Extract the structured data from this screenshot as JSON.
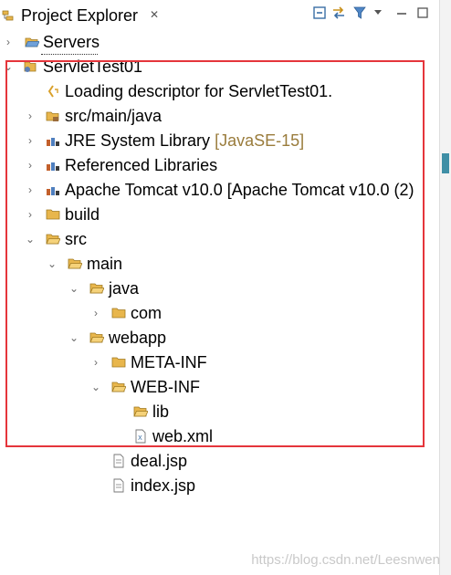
{
  "tab": {
    "title": "Project Explorer",
    "close": "✕"
  },
  "toolbar": [
    "collapse-all-icon",
    "link-with-editor-icon",
    "filter-icon",
    "view-menu-icon",
    "minimize-icon",
    "maximize-icon"
  ],
  "tree": [
    {
      "label": "Servers",
      "arrow": "›",
      "icon": "folder-open-icon"
    },
    {
      "label": "ServletTest01",
      "arrow": "⌄",
      "icon": "project-icon"
    },
    {
      "label": "Loading descriptor for ServletTest01.",
      "arrow": "",
      "icon": "loading-icon"
    },
    {
      "label": "src/main/java",
      "arrow": "›",
      "icon": "package-folder-icon"
    },
    {
      "label": "JRE System Library",
      "decoration": "[JavaSE-15]",
      "arrow": "›",
      "icon": "library-icon"
    },
    {
      "label": "Referenced Libraries",
      "arrow": "›",
      "icon": "library-icon"
    },
    {
      "label": "Apache Tomcat v10.0 [Apache Tomcat v10.0 (2)",
      "arrow": "›",
      "icon": "library-icon"
    },
    {
      "label": "build",
      "arrow": "›",
      "icon": "folder-icon"
    },
    {
      "label": "src",
      "arrow": "⌄",
      "icon": "folder-icon"
    },
    {
      "label": "main",
      "arrow": "⌄",
      "icon": "folder-icon"
    },
    {
      "label": "java",
      "arrow": "⌄",
      "icon": "folder-icon"
    },
    {
      "label": "com",
      "arrow": "›",
      "icon": "folder-icon"
    },
    {
      "label": "webapp",
      "arrow": "⌄",
      "icon": "folder-icon"
    },
    {
      "label": "META-INF",
      "arrow": "›",
      "icon": "folder-icon"
    },
    {
      "label": "WEB-INF",
      "arrow": "⌄",
      "icon": "folder-icon"
    },
    {
      "label": "lib",
      "arrow": "",
      "icon": "folder-icon"
    },
    {
      "label": "web.xml",
      "arrow": "",
      "icon": "xml-file-icon"
    },
    {
      "label": "deal.jsp",
      "arrow": "",
      "icon": "jsp-file-icon"
    },
    {
      "label": "index.jsp",
      "arrow": "",
      "icon": "jsp-file-icon"
    }
  ],
  "watermark": "https://blog.csdn.net/Leesnwen",
  "colors": {
    "annotation_box": "#e5353b",
    "folder": "#e8b64c",
    "decoration": "#9a7c3c"
  }
}
